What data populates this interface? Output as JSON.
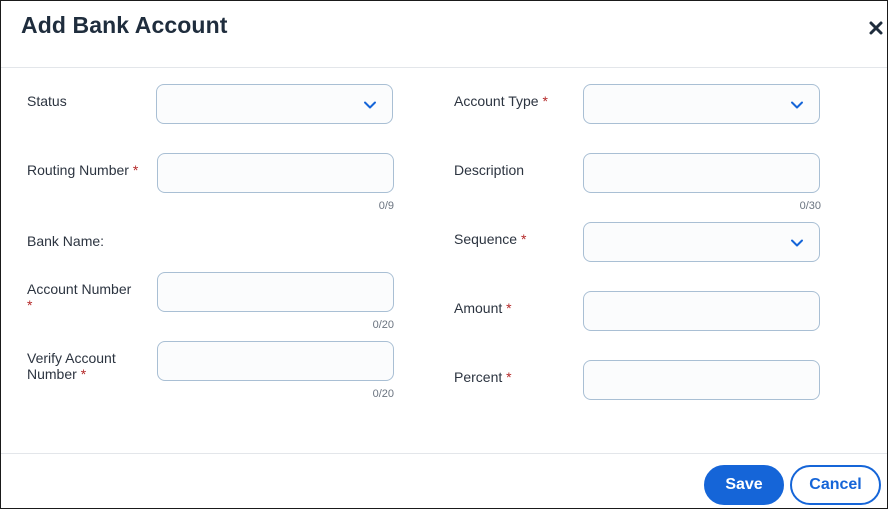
{
  "dialog": {
    "title": "Add Bank Account",
    "close_icon": "close-icon"
  },
  "required_marker": "*",
  "left_fields": {
    "status": {
      "label": "Status",
      "type": "select",
      "value": ""
    },
    "routing_number": {
      "label": "Routing Number",
      "required": true,
      "value": "",
      "counter": "0/9"
    },
    "bank_name": {
      "label": "Bank Name:"
    },
    "account_number": {
      "label": "Account Number",
      "required": true,
      "value": "",
      "counter": "0/20"
    },
    "verify_account_number": {
      "label_line1": "Verify Account",
      "label_line2": "Number",
      "required": true,
      "value": "",
      "counter": "0/20"
    }
  },
  "right_fields": {
    "account_type": {
      "label": "Account Type",
      "required": true,
      "type": "select",
      "value": ""
    },
    "description": {
      "label": "Description",
      "value": "",
      "counter": "0/30"
    },
    "sequence": {
      "label": "Sequence",
      "required": true,
      "type": "select",
      "value": ""
    },
    "amount": {
      "label": "Amount",
      "required": true,
      "value": ""
    },
    "percent": {
      "label": "Percent",
      "required": true,
      "value": ""
    }
  },
  "footer": {
    "save_label": "Save",
    "cancel_label": "Cancel"
  },
  "colors": {
    "primary": "#1565d8",
    "required": "#b42828",
    "input_border": "#a9bfd4"
  }
}
